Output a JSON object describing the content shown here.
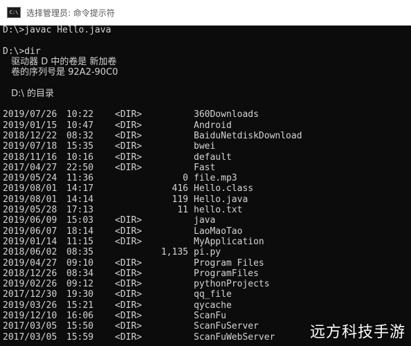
{
  "window": {
    "title": "选择管理员: 命令提示符",
    "icon_label": "C:\\"
  },
  "console": {
    "cmd1": "D:\\>javac Hello.java",
    "cmd2": "D:\\>dir",
    "volume_line": " 驱动器 D 中的卷是 新加卷",
    "serial_line": " 卷的序列号是 92A2-90C0",
    "dir_of": " D:\\ 的目录",
    "dir_tag": "<DIR>",
    "entries": [
      {
        "date": "2019/07/26",
        "time": "10:22",
        "dir": true,
        "size": "",
        "name": "360Downloads"
      },
      {
        "date": "2019/01/15",
        "time": "10:47",
        "dir": true,
        "size": "",
        "name": "Android"
      },
      {
        "date": "2018/12/22",
        "time": "08:32",
        "dir": true,
        "size": "",
        "name": "BaiduNetdiskDownload"
      },
      {
        "date": "2019/07/18",
        "time": "15:35",
        "dir": true,
        "size": "",
        "name": "bwei"
      },
      {
        "date": "2018/11/16",
        "time": "10:16",
        "dir": true,
        "size": "",
        "name": "default"
      },
      {
        "date": "2017/04/27",
        "time": "22:50",
        "dir": true,
        "size": "",
        "name": "Fast"
      },
      {
        "date": "2019/05/24",
        "time": "11:36",
        "dir": false,
        "size": "0",
        "name": "file.mp3"
      },
      {
        "date": "2019/08/01",
        "time": "14:17",
        "dir": false,
        "size": "416",
        "name": "Hello.class"
      },
      {
        "date": "2019/08/01",
        "time": "14:14",
        "dir": false,
        "size": "119",
        "name": "Hello.java"
      },
      {
        "date": "2019/05/28",
        "time": "17:13",
        "dir": false,
        "size": "11",
        "name": "hello.txt"
      },
      {
        "date": "2019/06/09",
        "time": "15:03",
        "dir": true,
        "size": "",
        "name": "java"
      },
      {
        "date": "2019/06/07",
        "time": "18:14",
        "dir": true,
        "size": "",
        "name": "LaoMaoTao"
      },
      {
        "date": "2019/01/14",
        "time": "11:15",
        "dir": true,
        "size": "",
        "name": "MyApplication"
      },
      {
        "date": "2018/06/02",
        "time": "08:35",
        "dir": false,
        "size": "1,135",
        "name": "pi.py"
      },
      {
        "date": "2019/04/27",
        "time": "09:10",
        "dir": true,
        "size": "",
        "name": "Program Files"
      },
      {
        "date": "2018/12/26",
        "time": "08:34",
        "dir": true,
        "size": "",
        "name": "ProgramFiles"
      },
      {
        "date": "2019/02/26",
        "time": "09:12",
        "dir": true,
        "size": "",
        "name": "pythonProjects"
      },
      {
        "date": "2017/12/30",
        "time": "19:30",
        "dir": true,
        "size": "",
        "name": "qq_file"
      },
      {
        "date": "2019/03/26",
        "time": "15:21",
        "dir": true,
        "size": "",
        "name": "qycache"
      },
      {
        "date": "2019/12/10",
        "time": "16:06",
        "dir": true,
        "size": "",
        "name": "ScanFu"
      },
      {
        "date": "2017/03/05",
        "time": "15:50",
        "dir": true,
        "size": "",
        "name": "ScanFuServer"
      },
      {
        "date": "2017/03/05",
        "time": "15:59",
        "dir": true,
        "size": "",
        "name": "ScanFuWebServer"
      }
    ]
  },
  "watermark": "远方科技手游"
}
